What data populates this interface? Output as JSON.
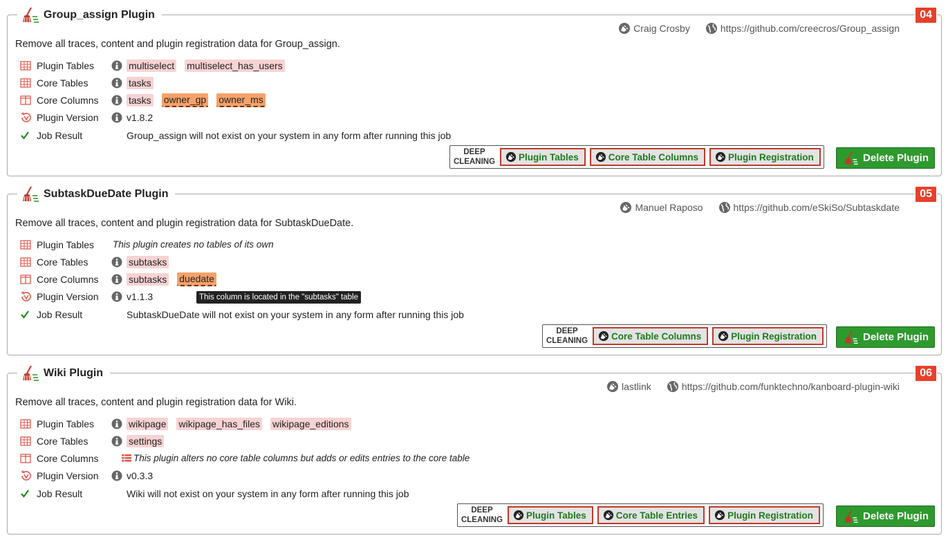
{
  "cards": [
    {
      "title": "Group_assign Plugin",
      "number": "04",
      "author": "Craig Crosby",
      "url": "https://github.com/creecros/Group_assign",
      "description": "Remove all traces, content and plugin registration data for Group_assign.",
      "labels": {
        "plugin_tables": "Plugin Tables",
        "core_tables": "Core Tables",
        "core_columns": "Core Columns",
        "plugin_version": "Plugin Version",
        "job_result": "Job Result"
      },
      "plugin_tables": [
        "multiselect",
        "multiselect_has_users"
      ],
      "core_tables": [
        "tasks"
      ],
      "core_columns_table": "tasks",
      "core_columns": [
        "owner_gp",
        "owner_ms"
      ],
      "version": "v1.8.2",
      "result": "Group_assign will not exist on your system in any form after running this job",
      "deep_label_1": "DEEP",
      "deep_label_2": "CLEANING",
      "deep_buttons": [
        "Plugin Tables",
        "Core Table Columns",
        "Plugin Registration"
      ],
      "delete_label": "Delete Plugin"
    },
    {
      "title": "SubtaskDueDate Plugin",
      "number": "05",
      "author": "Manuel Raposo",
      "url": "https://github.com/eSkiSo/Subtaskdate",
      "description": "Remove all traces, content and plugin registration data for SubtaskDueDate.",
      "labels": {
        "plugin_tables": "Plugin Tables",
        "core_tables": "Core Tables",
        "core_columns": "Core Columns",
        "plugin_version": "Plugin Version",
        "job_result": "Job Result"
      },
      "plugin_tables_note": "This plugin creates no tables of its own",
      "core_tables": [
        "subtasks"
      ],
      "core_columns_table": "subtasks",
      "core_columns": [
        "duedate"
      ],
      "tooltip": "This column is located in the \"subtasks\" table",
      "version": "v1.1.3",
      "result": "SubtaskDueDate will not exist on your system in any form after running this job",
      "deep_label_1": "DEEP",
      "deep_label_2": "CLEANING",
      "deep_buttons": [
        "Core Table Columns",
        "Plugin Registration"
      ],
      "delete_label": "Delete Plugin"
    },
    {
      "title": "Wiki Plugin",
      "number": "06",
      "author": "lastlink",
      "url": "https://github.com/funktechno/kanboard-plugin-wiki",
      "description": "Remove all traces, content and plugin registration data for Wiki.",
      "labels": {
        "plugin_tables": "Plugin Tables",
        "core_tables": "Core Tables",
        "core_columns": "Core Columns",
        "plugin_version": "Plugin Version",
        "job_result": "Job Result"
      },
      "plugin_tables": [
        "wikipage",
        "wikipage_has_files",
        "wikipage_editions"
      ],
      "core_tables": [
        "settings"
      ],
      "core_columns_note": "This plugin alters no core table columns but adds or edits entries to the core table",
      "version": "v0.3.3",
      "result": "Wiki will not exist on your system in any form after running this job",
      "deep_label_1": "DEEP",
      "deep_label_2": "CLEANING",
      "deep_buttons": [
        "Plugin Tables",
        "Core Table Entries",
        "Plugin Registration"
      ],
      "delete_label": "Delete Plugin"
    }
  ],
  "colors": {
    "badge": "#e8402a",
    "tag": "#f8d3d3",
    "column_tag": "#f5a26a",
    "delete_button": "#2e9a2e",
    "deep_border": "#c0392b",
    "deep_text": "#1e7a1e"
  },
  "icons": {
    "title": "broom-icon",
    "author": "plug-icon",
    "url": "globe-icon",
    "plugin_tables": "table-icon",
    "core_tables": "table-icon",
    "core_columns": "columns-icon",
    "plugin_version": "history-icon",
    "job_result": "check-icon",
    "info": "info-icon",
    "note": "list-icon"
  }
}
